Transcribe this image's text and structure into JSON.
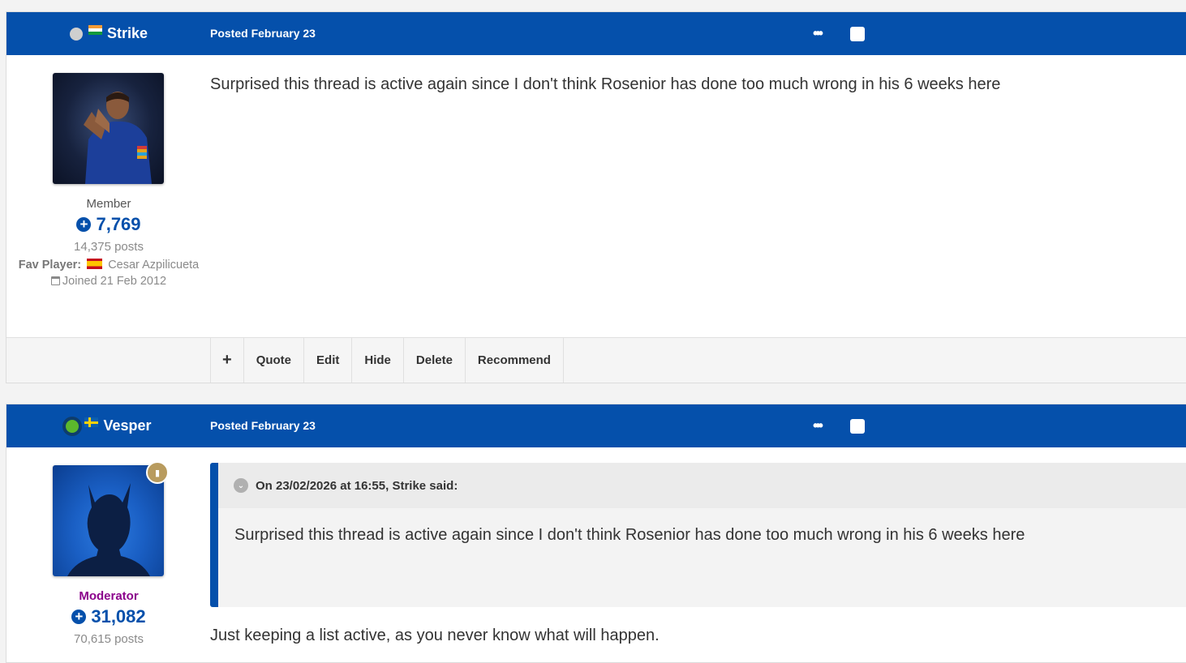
{
  "posts": [
    {
      "author": "Strike",
      "posted": "Posted February 23",
      "role": "Member",
      "reputation": "7,769",
      "post_count": "14,375 posts",
      "fav_label": "Fav Player:",
      "fav_player": "Cesar Azpilicueta",
      "joined": "Joined 21 Feb 2012",
      "content": "Surprised this thread is active again since I don't think Rosenior has done too much wrong in his 6 weeks here",
      "actions": {
        "plus": "+",
        "quote": "Quote",
        "edit": "Edit",
        "hide": "Hide",
        "delete": "Delete",
        "recommend": "Recommend"
      }
    },
    {
      "author": "Vesper",
      "posted": "Posted February 23",
      "role": "Moderator",
      "reputation": "31,082",
      "post_count": "70,615 posts",
      "quote_header": "On 23/02/2026 at 16:55, Strike said:",
      "quote_text": "Surprised this thread is active again since I don't think Rosenior has done too much wrong in his 6 weeks here",
      "content": "Just keeping a list active, as you never know what will happen."
    }
  ],
  "icons": {
    "more": "•••",
    "plus_circle": "+",
    "chevron": "⌄",
    "badge": "▮"
  },
  "colors": {
    "header_blue": "#0550ab",
    "moderator_purple": "#8b008b",
    "online_green": "#5cb82c"
  }
}
